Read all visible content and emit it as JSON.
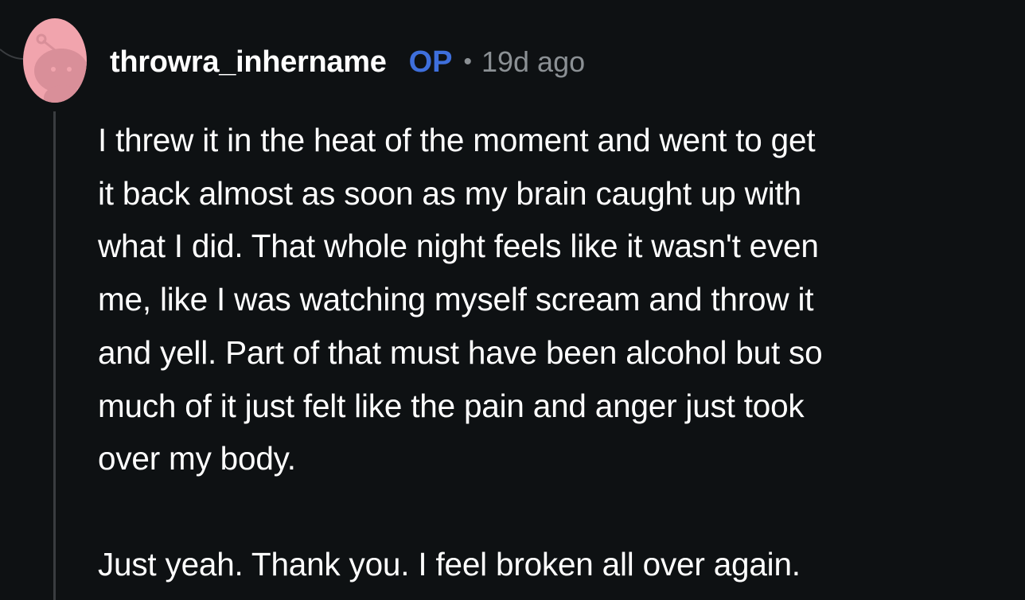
{
  "comment": {
    "username": "throwra_inhername",
    "op_badge": "OP",
    "separator": "•",
    "timestamp": "19d ago",
    "avatar_icon": "snoo-avatar-icon",
    "avatar_color": "#f1a4ad",
    "op_color": "#3e6fdc",
    "body": {
      "lines": [
        "I threw it in the heat of the moment and went to get",
        "it back almost as soon as my brain caught up with",
        "what I did. That whole night feels like it wasn't even",
        "me, like I was watching myself scream and throw it",
        "and yell. Part of that must have been alcohol but so",
        "much of it just felt like the pain and anger just took",
        "over my body."
      ],
      "last_paragraph": "Just yeah. Thank you. I feel broken all over again."
    }
  }
}
